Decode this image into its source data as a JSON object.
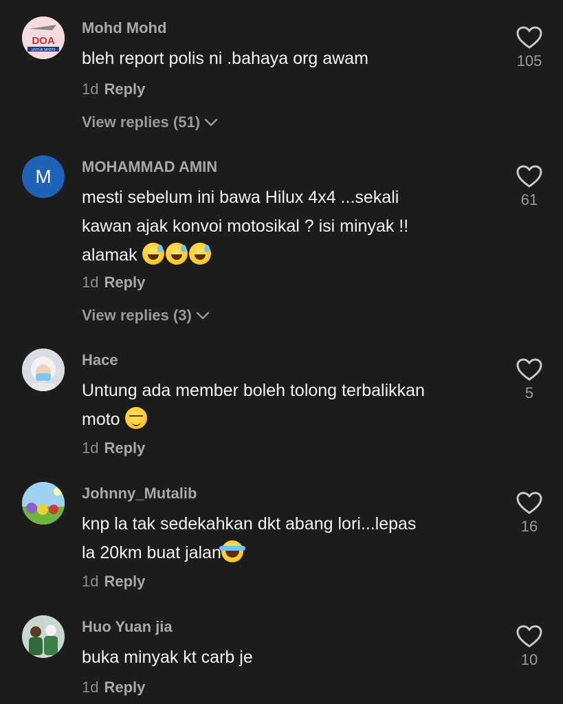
{
  "comments": [
    {
      "username": "Mohd Mohd",
      "text": "bleh report polis ni .bahaya org awam",
      "time": "1d",
      "reply_label": "Reply",
      "view_replies": "View replies (51)",
      "likes": "105",
      "avatar": {
        "type": "image",
        "logo_text": "DOA",
        "sub_text": "UNTUK MH370",
        "bg": "#f3dbe0",
        "accent": "#d32f2f"
      }
    },
    {
      "username": "MOHAMMAD AMIN",
      "text_lines": [
        "mesti sebelum ini bawa Hilux 4x4 ...sekali",
        "kawan ajak konvoi motosikal ? isi minyak !!",
        "alamak"
      ],
      "emojis": [
        "sweat-smile-emoji",
        "sweat-smile-emoji",
        "sweat-smile-emoji"
      ],
      "time": "1d",
      "reply_label": "Reply",
      "view_replies": "View replies (3)",
      "likes": "61",
      "avatar": {
        "type": "letter",
        "letter": "M",
        "bg": "#1e63b8"
      }
    },
    {
      "username": "Hace",
      "text_lines": [
        "Untung ada member boleh tolong terbalikkan",
        "moto"
      ],
      "emojis": [
        "relieved-emoji"
      ],
      "time": "1d",
      "reply_label": "Reply",
      "likes": "5",
      "avatar": {
        "type": "photo",
        "bg": "#cfd4dc"
      }
    },
    {
      "username": "Johnny_Mutalib",
      "text_lines": [
        "knp la tak sedekahkan dkt abang lori...lepas",
        "la 20km buat jalan"
      ],
      "emojis": [
        "tears-of-joy-emoji"
      ],
      "time": "1d",
      "reply_label": "Reply",
      "likes": "16",
      "avatar": {
        "type": "photo",
        "bg": "#7fb84a"
      }
    },
    {
      "username": "Huo Yuan jia",
      "text": "buka minyak kt carb je",
      "time": "1d",
      "reply_label": "Reply",
      "likes": "10",
      "avatar": {
        "type": "photo",
        "bg": "#5f7a5a"
      }
    }
  ],
  "icons": {
    "like": "heart-outline-icon",
    "expand": "chevron-down-icon"
  },
  "colors": {
    "background": "#1c1c1c",
    "text": "#f2f2f2",
    "secondary": "#8e8e8e"
  }
}
